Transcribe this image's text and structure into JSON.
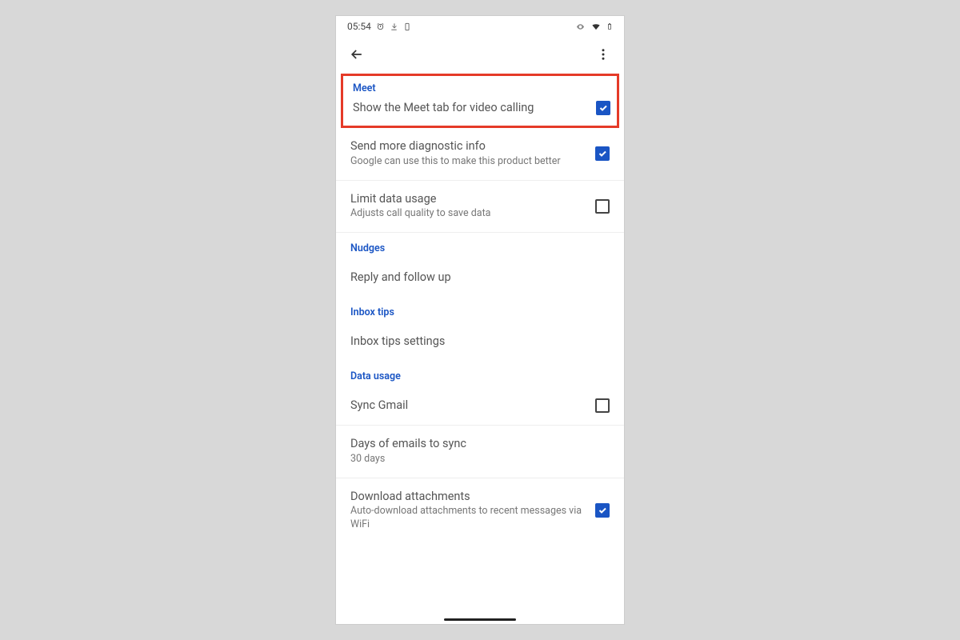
{
  "status": {
    "time": "05:54",
    "icons_left": [
      "alarm-icon",
      "download-icon",
      "phone-icon"
    ],
    "icons_right": [
      "eye-icon",
      "wifi-icon",
      "battery-icon"
    ]
  },
  "appbar": {
    "back": "back-arrow-icon",
    "menu": "more-vert-icon"
  },
  "sections": {
    "meet": {
      "header": "Meet",
      "items": [
        {
          "title": "Show the Meet tab for video calling",
          "sub": "",
          "checked": true
        },
        {
          "title": "Send more diagnostic info",
          "sub": "Google can use this to make this product better",
          "checked": true
        },
        {
          "title": "Limit data usage",
          "sub": "Adjusts call quality to save data",
          "checked": false
        }
      ]
    },
    "nudges": {
      "header": "Nudges",
      "items": [
        {
          "title": "Reply and follow up",
          "sub": ""
        }
      ]
    },
    "inbox_tips": {
      "header": "Inbox tips",
      "items": [
        {
          "title": "Inbox tips settings",
          "sub": ""
        }
      ]
    },
    "data_usage": {
      "header": "Data usage",
      "items": [
        {
          "title": "Sync Gmail",
          "sub": "",
          "checked": false
        },
        {
          "title": "Days of emails to sync",
          "sub": "30 days"
        },
        {
          "title": "Download attachments",
          "sub": "Auto-download attachments to recent messages via WiFi",
          "checked": true
        }
      ]
    }
  }
}
